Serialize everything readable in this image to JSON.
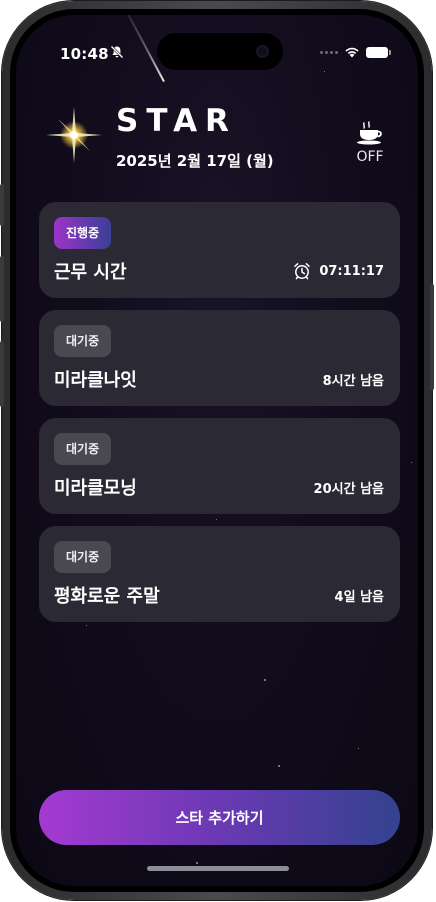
{
  "status_bar": {
    "time": "10:48",
    "silent_icon": "bell-slash-icon",
    "wifi_icon": "wifi-icon",
    "battery_icon": "battery-icon"
  },
  "header": {
    "logo_icon": "sparkle-star-icon",
    "title": "STAR",
    "date": "2025년 2월 17일 (월)",
    "break_toggle": {
      "icon": "coffee-cup-icon",
      "label": "OFF"
    }
  },
  "stars": [
    {
      "status": "진행중",
      "status_type": "active",
      "title": "근무 시간",
      "right_icon": "alarm-clock-icon",
      "right_text": "07:11:17"
    },
    {
      "status": "대기중",
      "status_type": "waiting",
      "title": "미라클나잇",
      "right_text": "8시간 남음"
    },
    {
      "status": "대기중",
      "status_type": "waiting",
      "title": "미라클모닝",
      "right_text": "20시간 남음"
    },
    {
      "status": "대기중",
      "status_type": "waiting",
      "title": "평화로운 주말",
      "right_text": "4일 남음"
    }
  ],
  "add_button": {
    "label": "스타 추가하기"
  },
  "colors": {
    "background": "#120c1d",
    "card": "#2b2934",
    "accent_start": "#a43ad1",
    "accent_end": "#33428e",
    "waiting_badge": "#4a4950",
    "logo_glow": "#f7d04a"
  }
}
